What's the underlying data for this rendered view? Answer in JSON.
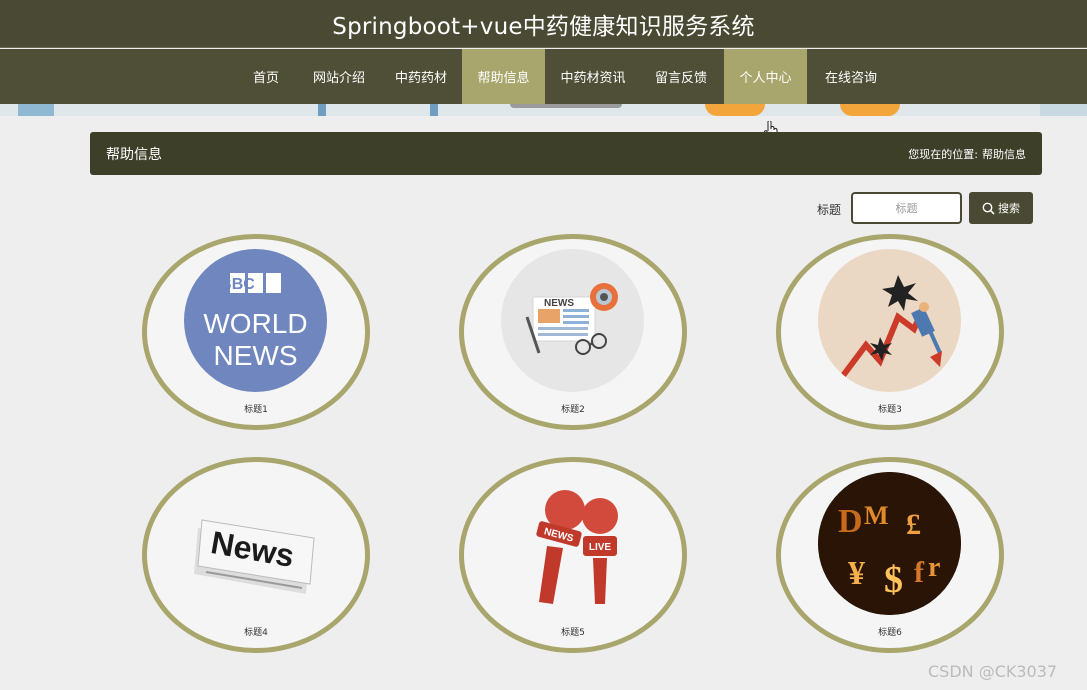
{
  "header": {
    "title": "Springboot+vue中药健康知识服务系统"
  },
  "nav": {
    "items": [
      {
        "label": "首页"
      },
      {
        "label": "网站介绍"
      },
      {
        "label": "中药药材"
      },
      {
        "label": "帮助信息"
      },
      {
        "label": "中药材资讯"
      },
      {
        "label": "留言反馈"
      },
      {
        "label": "个人中心"
      },
      {
        "label": "在线咨询"
      }
    ],
    "active": "帮助信息",
    "hovered": "个人中心"
  },
  "section": {
    "title": "帮助信息",
    "breadcrumb_prefix": "您现在的位置:",
    "breadcrumb_current": "帮助信息"
  },
  "search": {
    "label": "标题",
    "placeholder": "标题",
    "button_label": "搜索"
  },
  "cards": [
    {
      "caption": "标题1",
      "image_text_1": "BBC",
      "image_text_2": "WORLD",
      "image_text_3": "NEWS"
    },
    {
      "caption": "标题2",
      "image_text": "NEWS"
    },
    {
      "caption": "标题3"
    },
    {
      "caption": "标题4",
      "image_text": "News"
    },
    {
      "caption": "标题5",
      "image_text_1": "NEWS",
      "image_text_2": "LIVE"
    },
    {
      "caption": "标题6"
    }
  ],
  "watermark": "CSDN @CK3037",
  "colors": {
    "header_bg": "#4a4a34",
    "active_nav": "#a8a66c",
    "section_bar": "#3d3f29",
    "card_ring": "#a8a66c"
  }
}
